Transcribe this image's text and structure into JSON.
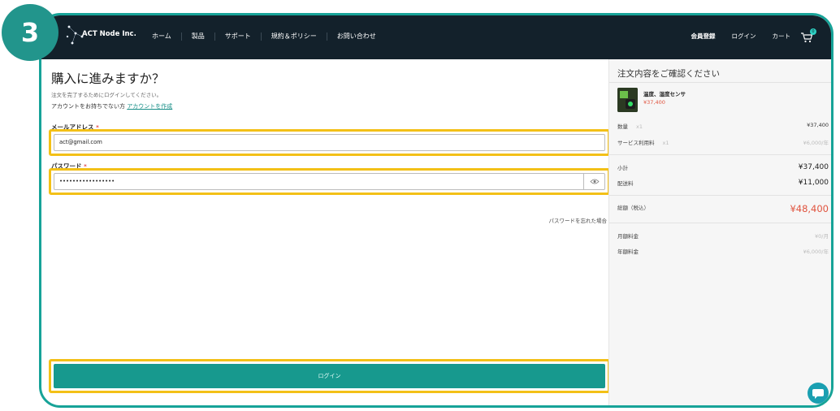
{
  "step": "3",
  "brand": {
    "name": "ACT Node Inc."
  },
  "nav": [
    "ホーム",
    "製品",
    "サポート",
    "規約＆ポリシー",
    "お問い合わせ"
  ],
  "right_nav": {
    "signup": "会員登録",
    "login": "ログイン",
    "cart": "カート",
    "cart_count": "0"
  },
  "main": {
    "title": "購入に進みますか？",
    "subtitle": "注文を完了するためにログインしてください。",
    "no_account_text": "アカウントをお持ちでない方",
    "create_account_link": "アカウントを作成",
    "email_label": "メールアドレス",
    "email_value": "act@gmail.com",
    "password_label": "パスワード",
    "password_value": "•••••••••••••••••",
    "required_mark": "*",
    "forgot_password": "パスワードを忘れた場合",
    "login_button": "ログイン"
  },
  "summary": {
    "title": "注文内容をご確認ください",
    "product_name": "温度、湿度センサ",
    "product_price": "¥37,400",
    "qty_label": "数量",
    "qty_mult": "x1",
    "qty_value": "¥37,400",
    "service_label": "サービス利用料",
    "service_mult": "x1",
    "service_value": "¥6,000/年",
    "subtotal_label": "小計",
    "subtotal_value": "¥37,400",
    "shipping_label": "配送料",
    "shipping_value": "¥11,000",
    "total_label": "総額（税込）",
    "total_value": "¥48,400",
    "monthly_label": "月額料金",
    "monthly_value": "¥0/月",
    "annual_label": "年額料金",
    "annual_value": "¥6,000/年"
  },
  "colors": {
    "accent": "#17998e",
    "highlight": "#f3c017",
    "header": "#13212b",
    "price": "#e0533e"
  }
}
